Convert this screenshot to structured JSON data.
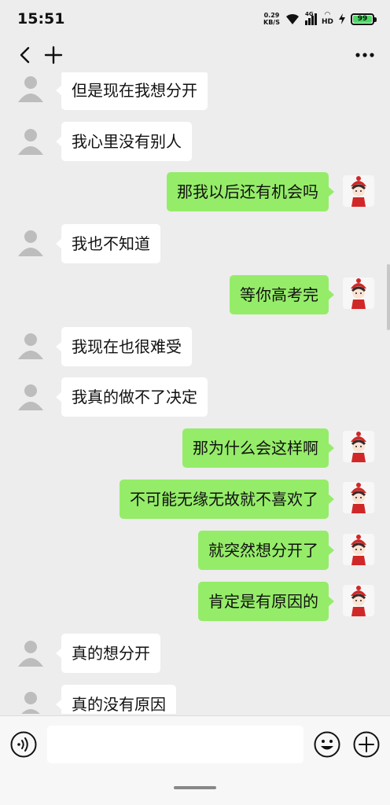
{
  "status_bar": {
    "time": "15:51",
    "net_speed_value": "0.29",
    "net_speed_unit": "KB/S",
    "signal_label": "4G",
    "hd_label": "HD",
    "battery_level": "99"
  },
  "messages": [
    {
      "side": "left",
      "text": "但是现在我想分开"
    },
    {
      "side": "left",
      "text": "我心里没有别人"
    },
    {
      "side": "right",
      "text": "那我以后还有机会吗"
    },
    {
      "side": "left",
      "text": "我也不知道"
    },
    {
      "side": "right",
      "text": "等你高考完"
    },
    {
      "side": "left",
      "text": "我现在也很难受"
    },
    {
      "side": "left",
      "text": "我真的做不了决定"
    },
    {
      "side": "right",
      "text": "那为什么会这样啊"
    },
    {
      "side": "right",
      "text": "不可能无缘无故就不喜欢了"
    },
    {
      "side": "right",
      "text": "就突然想分开了"
    },
    {
      "side": "right",
      "text": "肯定是有原因的"
    },
    {
      "side": "left",
      "text": "真的想分开"
    },
    {
      "side": "left",
      "text": "真的没有原因"
    }
  ],
  "colors": {
    "background": "#ededed",
    "bubble_self": "#95ec69",
    "bubble_other": "#ffffff"
  },
  "icons": {
    "back": "chevron-left-icon",
    "add": "plus-icon",
    "more": "more-dots-icon",
    "voice": "voice-icon",
    "emoji": "emoji-icon",
    "plus": "plus-circle-icon"
  }
}
